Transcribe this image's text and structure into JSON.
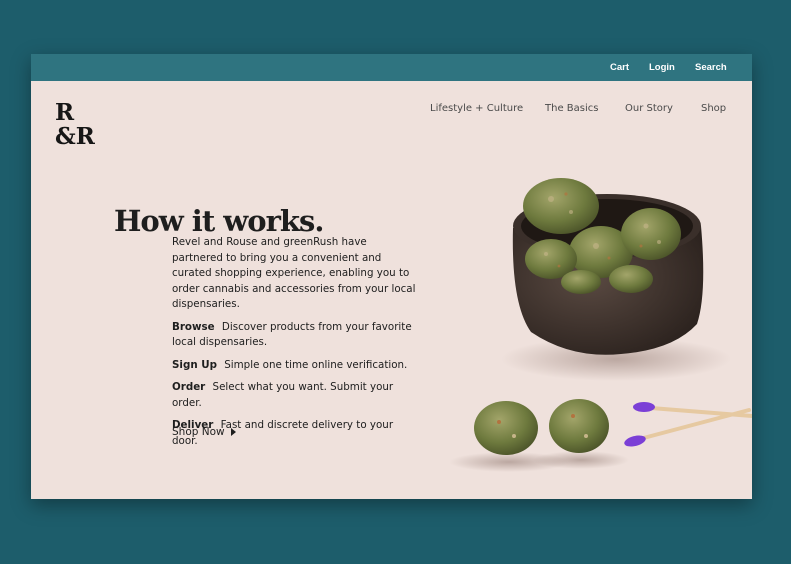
{
  "topbar": {
    "cart": "Cart",
    "login": "Login",
    "search": "Search",
    "color": "#2f7480"
  },
  "logo": {
    "line1": "R",
    "line2": "&R"
  },
  "nav": {
    "items": [
      "Lifestyle + Culture",
      "The Basics",
      "Our Story",
      "Shop"
    ]
  },
  "hero": {
    "title": "How it works.",
    "intro": "Revel and Rouse and greenRush have partnered to bring you a convenient and curated shopping experience, enabling you to order cannabis and accessories from your local dispensaries.",
    "steps": [
      {
        "label": "Browse",
        "text": "Discover products from your favorite local dispensaries."
      },
      {
        "label": "Sign Up",
        "text": "Simple one time online verification."
      },
      {
        "label": "Order",
        "text": "Select what you want. Submit your order."
      },
      {
        "label": "Deliver",
        "text": "Fast and discrete delivery to your door."
      }
    ],
    "cta": "Shop Now"
  },
  "colors": {
    "page_bg": "#1d5d6b",
    "panel_bg": "#efe1dc",
    "match_head": "#7b3fd6"
  }
}
